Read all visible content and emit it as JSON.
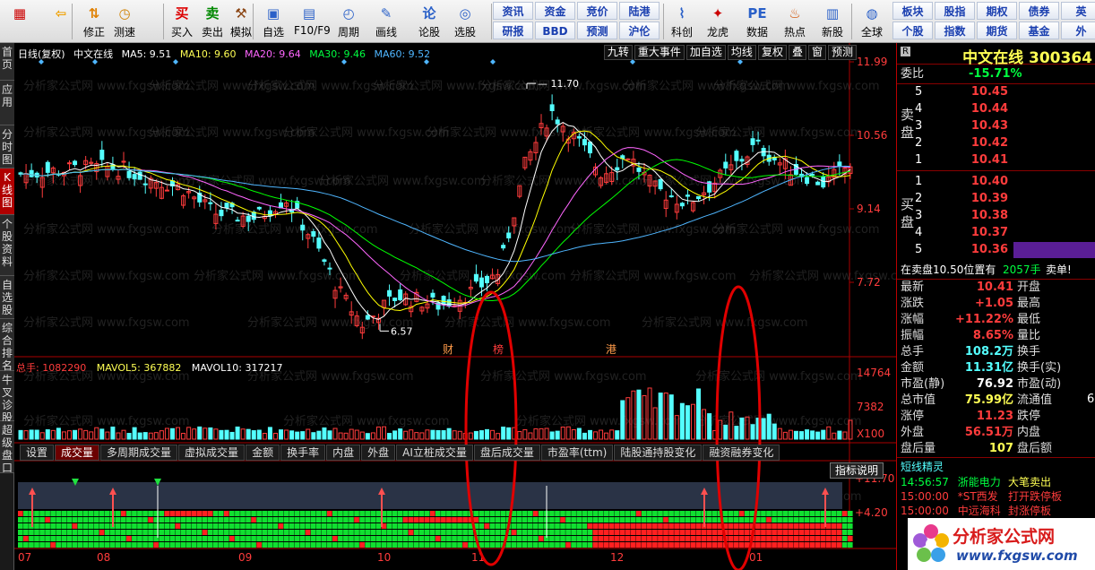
{
  "toolbar": {
    "buttons": [
      {
        "label": "",
        "icon": "grid-icon"
      },
      {
        "label": "",
        "icon": "back-arrow-icon"
      },
      {
        "label": "修正",
        "icon": "up-down-arrow-icon"
      },
      {
        "label": "测速",
        "icon": "clock-icon"
      },
      {
        "label": "买入",
        "icon": "buy-icon",
        "glyph": "买"
      },
      {
        "label": "卖出",
        "icon": "sell-icon",
        "glyph": "卖"
      },
      {
        "label": "模拟",
        "icon": "hammer-icon"
      },
      {
        "label": "自选",
        "icon": "folder-icon"
      },
      {
        "label": "F10/F9",
        "icon": "document-icon"
      },
      {
        "label": "周期",
        "icon": "cycle-icon"
      },
      {
        "label": "画线",
        "icon": "pencil-icon"
      },
      {
        "label": "论股",
        "icon": "discuss-icon",
        "glyph": "论"
      },
      {
        "label": "选股",
        "icon": "pick-stock-icon"
      },
      {
        "label": "科创",
        "icon": "star-market-icon"
      },
      {
        "label": "龙虎",
        "icon": "dragon-tiger-icon"
      },
      {
        "label": "数据",
        "icon": "pe-icon",
        "glyph": "PE"
      },
      {
        "label": "热点",
        "icon": "hot-icon"
      },
      {
        "label": "新股",
        "icon": "new-stock-icon"
      },
      {
        "label": "全球",
        "icon": "globe-icon"
      }
    ],
    "small_top": [
      "资讯",
      "资金",
      "竞价",
      "陆港"
    ],
    "small_bottom": [
      "研报",
      "BBD",
      "预测",
      "沪伦"
    ],
    "small_right_top": [
      "板块",
      "股指",
      "期权",
      "债券",
      "英"
    ],
    "small_right_bottom": [
      "个股",
      "指数",
      "期货",
      "基金",
      "外"
    ]
  },
  "sidebar": {
    "tabs": [
      "首页",
      "应用",
      "分时图",
      "K线图",
      "个股资料",
      "自选股",
      "综合排名",
      "牛叉诊股",
      "超级盘口"
    ]
  },
  "chart": {
    "info": {
      "period": "日线(复权)",
      "name": "中文在线",
      "ma5": "MA5: 9.51",
      "ma10": "MA10: 9.60",
      "ma20": "MA20: 9.64",
      "ma30": "MA30: 9.46",
      "ma60": "MA60: 9.52"
    },
    "tools": [
      "九转",
      "重大事件",
      "加自选",
      "均线",
      "复权",
      "叠",
      "窗",
      "预测"
    ],
    "price_axis": [
      "11.99",
      "10.56",
      "9.14",
      "7.72"
    ],
    "high_mark": "11.70",
    "low_mark": "6.57",
    "event_marks": [
      "财",
      "榜",
      "港"
    ],
    "vol_info": {
      "total": "总手: 1082290",
      "mavol5": "MAVOL5: 367882",
      "mavol10": "MAVOL10: 317217"
    },
    "vol_axis": [
      "14764",
      "7382",
      "X100"
    ],
    "indicator_tabs": [
      "设置",
      "成交量",
      "多周期成交量",
      "虚拟成交量",
      "金额",
      "换手率",
      "内盘",
      "外盘",
      "AI立桩成交量",
      "盘后成交量",
      "市盈率(ttm)",
      "陆股通持股变化",
      "融资融券变化"
    ],
    "indicator_button": "指标说明",
    "ind_axis": [
      "+11.70",
      "+4.20"
    ],
    "x_axis": [
      "07",
      "08",
      "09",
      "10",
      "11",
      "12",
      "01"
    ],
    "watermark": "分析家公式网 www.fxgsw.com",
    "colors": {
      "up": "#ff3c3c",
      "down": "#54ffff",
      "ma5": "#ffffff",
      "ma10": "#ffff00",
      "ma20": "#ff66ff",
      "ma30": "#00ff00",
      "ma60": "#4fb6ff"
    }
  },
  "panel": {
    "r_badge": "R",
    "title": "中文在线 300364",
    "weibi_label": "委比",
    "weibi_value": "-15.71%",
    "sell_label": "卖盘",
    "buy_label": "买盘",
    "sell": [
      {
        "level": "5",
        "price": "10.45"
      },
      {
        "level": "4",
        "price": "10.44"
      },
      {
        "level": "3",
        "price": "10.43"
      },
      {
        "level": "2",
        "price": "10.42"
      },
      {
        "level": "1",
        "price": "10.41"
      }
    ],
    "buy": [
      {
        "level": "1",
        "price": "10.40"
      },
      {
        "level": "2",
        "price": "10.39"
      },
      {
        "level": "3",
        "price": "10.38"
      },
      {
        "level": "4",
        "price": "10.37"
      },
      {
        "level": "5",
        "price": "10.36"
      }
    ],
    "trade_note": "在卖盘10.50位置有",
    "trade_qty": "2057手",
    "trade_side": "卖单!",
    "quotes": [
      {
        "label": "最新",
        "value": "10.41",
        "label2": "开盘",
        "color": "red"
      },
      {
        "label": "涨跌",
        "value": "+1.05",
        "label2": "最高",
        "color": "red"
      },
      {
        "label": "涨幅",
        "value": "+11.22%",
        "label2": "最低",
        "color": "red"
      },
      {
        "label": "振幅",
        "value": "8.65%",
        "label2": "量比",
        "color": "red"
      },
      {
        "label": "总手",
        "value": "108.2万",
        "label2": "换手",
        "color": "cyan"
      },
      {
        "label": "金额",
        "value": "11.31亿",
        "label2": "换手(实)",
        "color": "cyan"
      },
      {
        "label": "市盈(静)",
        "value": "76.92",
        "label2": "市盈(动)",
        "color": "white"
      },
      {
        "label": "总市值",
        "value": "75.99亿",
        "label2": "流通值",
        "color": "yellow"
      },
      {
        "label": "涨停",
        "value": "11.23",
        "label2": "跌停",
        "color": "red"
      },
      {
        "label": "外盘",
        "value": "56.51万",
        "label2": "内盘",
        "color": "red"
      },
      {
        "label": "盘后量",
        "value": "107",
        "label2": "盘后额",
        "color": "yellow"
      }
    ],
    "quote_right_partial": "6",
    "news_title": "短线精灵",
    "news": [
      {
        "time": "14:56:57",
        "stock": "浙能电力",
        "event": "大笔卖出",
        "color": "green"
      },
      {
        "time": "15:00:00",
        "stock": "*ST西发",
        "event": "打开跌停板",
        "color": "red"
      },
      {
        "time": "15:00:00",
        "stock": "中远海科",
        "event": "封涨停板",
        "color": "red"
      }
    ],
    "logo_text": "分析家公式网",
    "logo_url": "www.fxgsw.com"
  }
}
